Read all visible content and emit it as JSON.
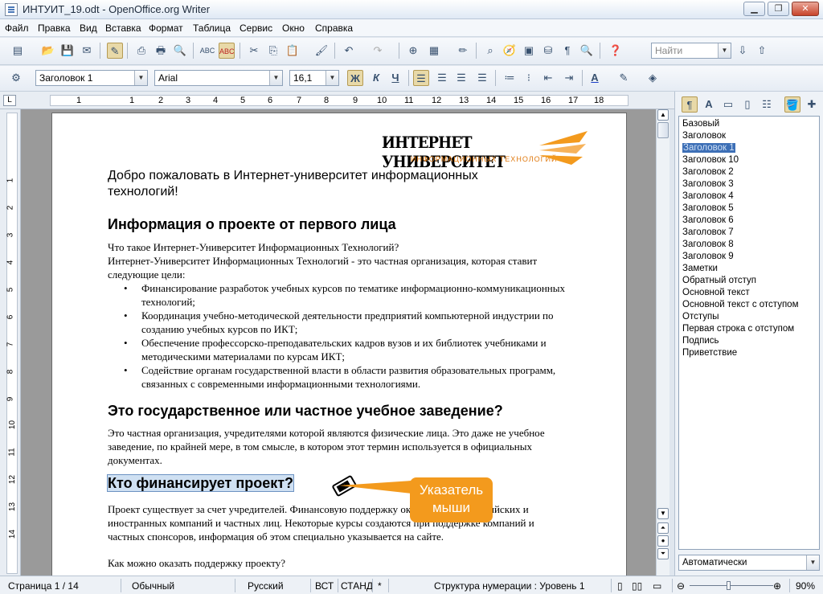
{
  "window": {
    "title": "ИНТУИТ_19.odt - OpenOffice.org Writer"
  },
  "menu": [
    "Файл",
    "Правка",
    "Вид",
    "Вставка",
    "Формат",
    "Таблица",
    "Сервис",
    "Окно",
    "Справка"
  ],
  "find": {
    "placeholder": "Найти"
  },
  "formatting": {
    "style": "Заголовок 1",
    "font": "Arial",
    "size": "16,1",
    "bold": "Ж",
    "italic": "К",
    "underline": "Ч"
  },
  "ruler": {
    "h": [
      "1",
      "1",
      "2",
      "3",
      "4",
      "5",
      "6",
      "7",
      "8",
      "9",
      "10",
      "11",
      "12",
      "13",
      "14",
      "15",
      "16",
      "17",
      "18"
    ],
    "v": [
      "1",
      "2",
      "3",
      "4",
      "5",
      "6",
      "7",
      "8",
      "9",
      "10",
      "11",
      "12",
      "13",
      "14"
    ]
  },
  "logo": {
    "main": "ИНТЕРНЕТ УНИВЕРСИТЕТ",
    "sub": "ИНФОРМАЦИОННЫХ ТЕХНОЛОГИЙ"
  },
  "doc": {
    "welcome": "Добро пожаловать в Интернет-университет информационных технологий!",
    "h1": "Информация о проекте от первого лица",
    "p1a": "Что такое Интернет-Университет Информационных Технологий?",
    "p1b": "Интернет-Университет Информационных Технологий - это частная организация, которая ставит следующие цели:",
    "bullets": [
      "Финансирование разработок учебных курсов по тематике информационно-коммуникационных технологий;",
      "Координация учебно-методической деятельности предприятий компьютерной индустрии по созданию учебных курсов по ИКТ;",
      "Обеспечение профессорско-преподавательских кадров вузов и их библиотек учебниками и методическими материалами по курсам ИКТ;",
      "Содействие органам государственной власти в области развития образовательных программ, связанных с современными информационными технологиями."
    ],
    "h2": "Это государственное или частное учебное заведение?",
    "p2": "Это частная организация, учредителями которой являются физические лица. Это даже не учебное заведение, по крайней мере, в том смысле, в котором этот термин используется в официальных документах.",
    "h3": "Кто финансирует проект?",
    "p3": "Проект существует за счет учредителей. Финансовую поддержку оказывают ряд российских и иностранных компаний и частных лиц. Некоторые курсы создаются при поддержке компаний и частных спонсоров, информация об этом специально указывается на сайте.",
    "p4": "Как можно оказать поддержку проекту?"
  },
  "callout": "Указатель мыши",
  "styles": {
    "items": [
      "Базовый",
      "Заголовок",
      "Заголовок 1",
      "Заголовок 10",
      "Заголовок 2",
      "Заголовок 3",
      "Заголовок 4",
      "Заголовок 5",
      "Заголовок 6",
      "Заголовок 7",
      "Заголовок 8",
      "Заголовок 9",
      "Заметки",
      "Обратный отступ",
      "Основной текст",
      "Основной текст с отступом",
      "Отступы",
      "Первая строка с отступом",
      "Подпись",
      "Приветствие"
    ],
    "selected": "Заголовок 1",
    "filter": "Автоматически"
  },
  "status": {
    "page": "Страница  1 / 14",
    "style": "Обычный",
    "lang": "Русский",
    "ins": "ВСТ",
    "sel": "СТАНД",
    "mod": "*",
    "outline": "Структура нумерации : Уровень 1",
    "zoom": "90%"
  },
  "colors": {
    "accent": "#3d6fb6",
    "callout": "#f39a1d",
    "highlight": "#cfe0f2"
  }
}
